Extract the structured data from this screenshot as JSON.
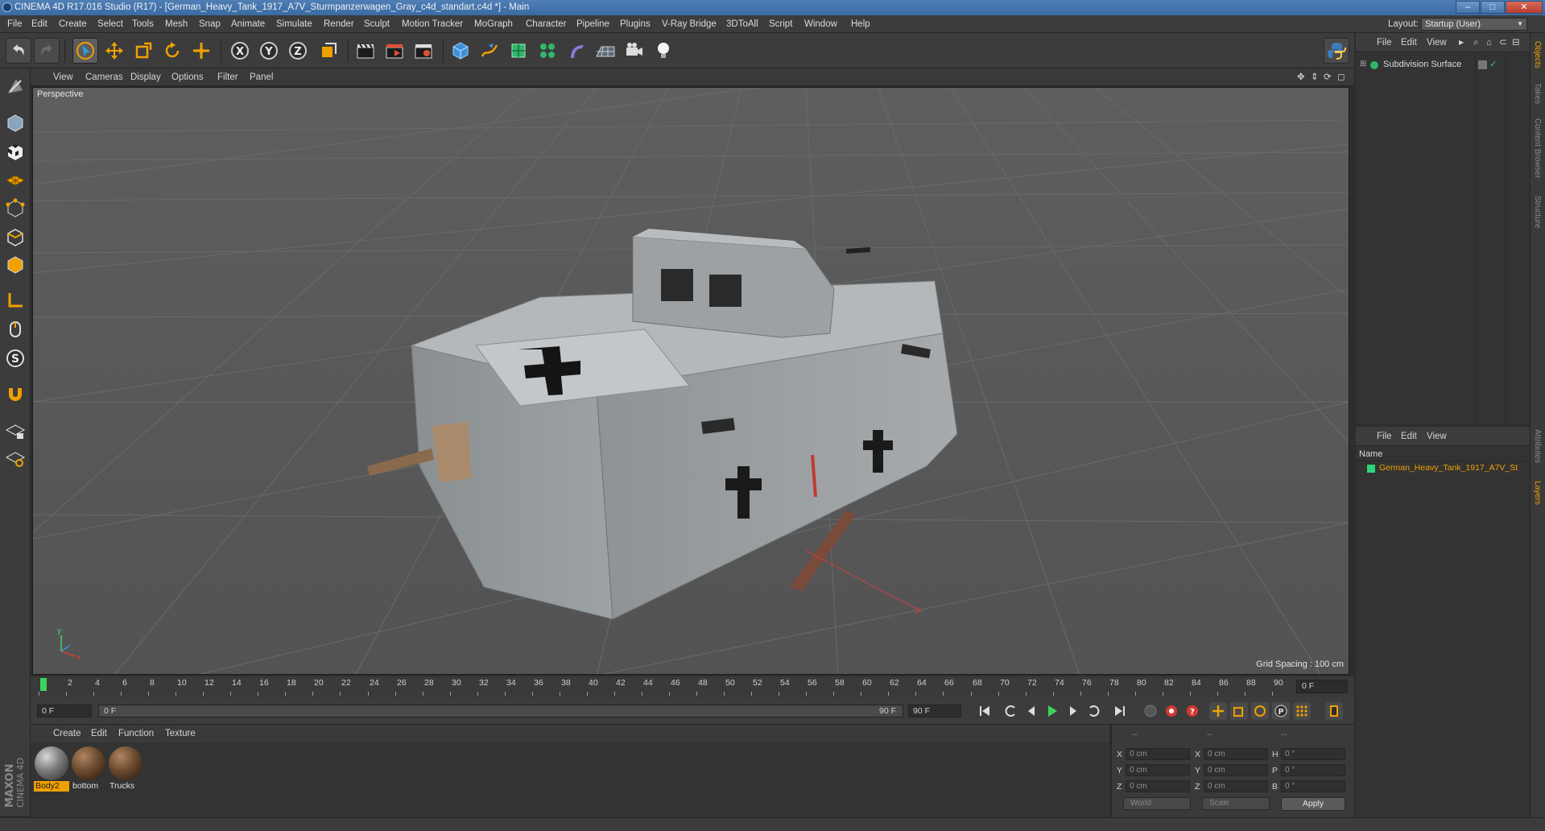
{
  "window": {
    "title": "CINEMA 4D R17.016 Studio (R17) - [German_Heavy_Tank_1917_A7V_Sturmpanzerwagen_Gray_c4d_standart.c4d *] - Main"
  },
  "menubar": {
    "items": [
      "File",
      "Edit",
      "Create",
      "Select",
      "Tools",
      "Mesh",
      "Snap",
      "Animate",
      "Simulate",
      "Render",
      "Sculpt",
      "Motion Tracker",
      "MoGraph",
      "Character",
      "Pipeline",
      "Plugins",
      "V-Ray Bridge",
      "3DToAll",
      "Script",
      "Window",
      "Help"
    ],
    "layout_label": "Layout:",
    "layout_value": "Startup (User)"
  },
  "viewport": {
    "menu": [
      "View",
      "Cameras",
      "Display",
      "Options",
      "Filter",
      "Panel"
    ],
    "label": "Perspective",
    "grid_spacing": "Grid Spacing : 100 cm"
  },
  "timeline": {
    "ticks": [
      "0",
      "2",
      "4",
      "6",
      "8",
      "10",
      "12",
      "14",
      "16",
      "18",
      "20",
      "22",
      "24",
      "26",
      "28",
      "30",
      "32",
      "34",
      "36",
      "38",
      "40",
      "42",
      "44",
      "46",
      "48",
      "50",
      "52",
      "54",
      "56",
      "58",
      "60",
      "62",
      "64",
      "66",
      "68",
      "70",
      "72",
      "74",
      "76",
      "78",
      "80",
      "82",
      "84",
      "86",
      "88",
      "90"
    ],
    "current_frame": "0 F",
    "start_field": "0 F",
    "range_start": "0 F",
    "range_end": "90 F",
    "end_field": "90 F"
  },
  "materials": {
    "menu": [
      "Create",
      "Edit",
      "Function",
      "Texture"
    ],
    "items": [
      {
        "name": "Body2",
        "color": "#9a9a9a",
        "active": true
      },
      {
        "name": "bottom",
        "color": "#6b4b30",
        "active": false
      },
      {
        "name": "Trucks",
        "color": "#6b4b30",
        "active": false
      }
    ]
  },
  "coordinates": {
    "headers": [
      "--",
      "--",
      "--"
    ],
    "rows": [
      {
        "l1": "X",
        "v1": "0 cm",
        "l2": "X",
        "v2": "0 cm",
        "l3": "H",
        "v3": "0 °"
      },
      {
        "l1": "Y",
        "v1": "0 cm",
        "l2": "Y",
        "v2": "0 cm",
        "l3": "P",
        "v3": "0 °"
      },
      {
        "l1": "Z",
        "v1": "0 cm",
        "l2": "Z",
        "v2": "0 cm",
        "l3": "B",
        "v3": "0 °"
      }
    ],
    "mode1": "World",
    "mode2": "Scale",
    "apply_label": "Apply"
  },
  "objects_panel": {
    "menu": [
      "File",
      "Edit",
      "View"
    ],
    "items": [
      {
        "name": "Subdivision Surface"
      }
    ]
  },
  "layers_panel": {
    "menu": [
      "File",
      "Edit",
      "View"
    ],
    "column_name": "Name",
    "items": [
      {
        "name": "German_Heavy_Tank_1917_A7V_St",
        "color": "#2ed37a"
      }
    ]
  },
  "side_tabs": [
    "Objects",
    "Takes",
    "Content Browser",
    "Structure",
    "Attributes",
    "Layers"
  ],
  "brand": {
    "maxon": "MAXON",
    "product": "CINEMA 4D"
  },
  "colors": {
    "accent_orange": "#f0a000",
    "axis_red": "#d04040",
    "axis_green": "#3cd35a",
    "selection_blue": "#3a6aa3"
  }
}
